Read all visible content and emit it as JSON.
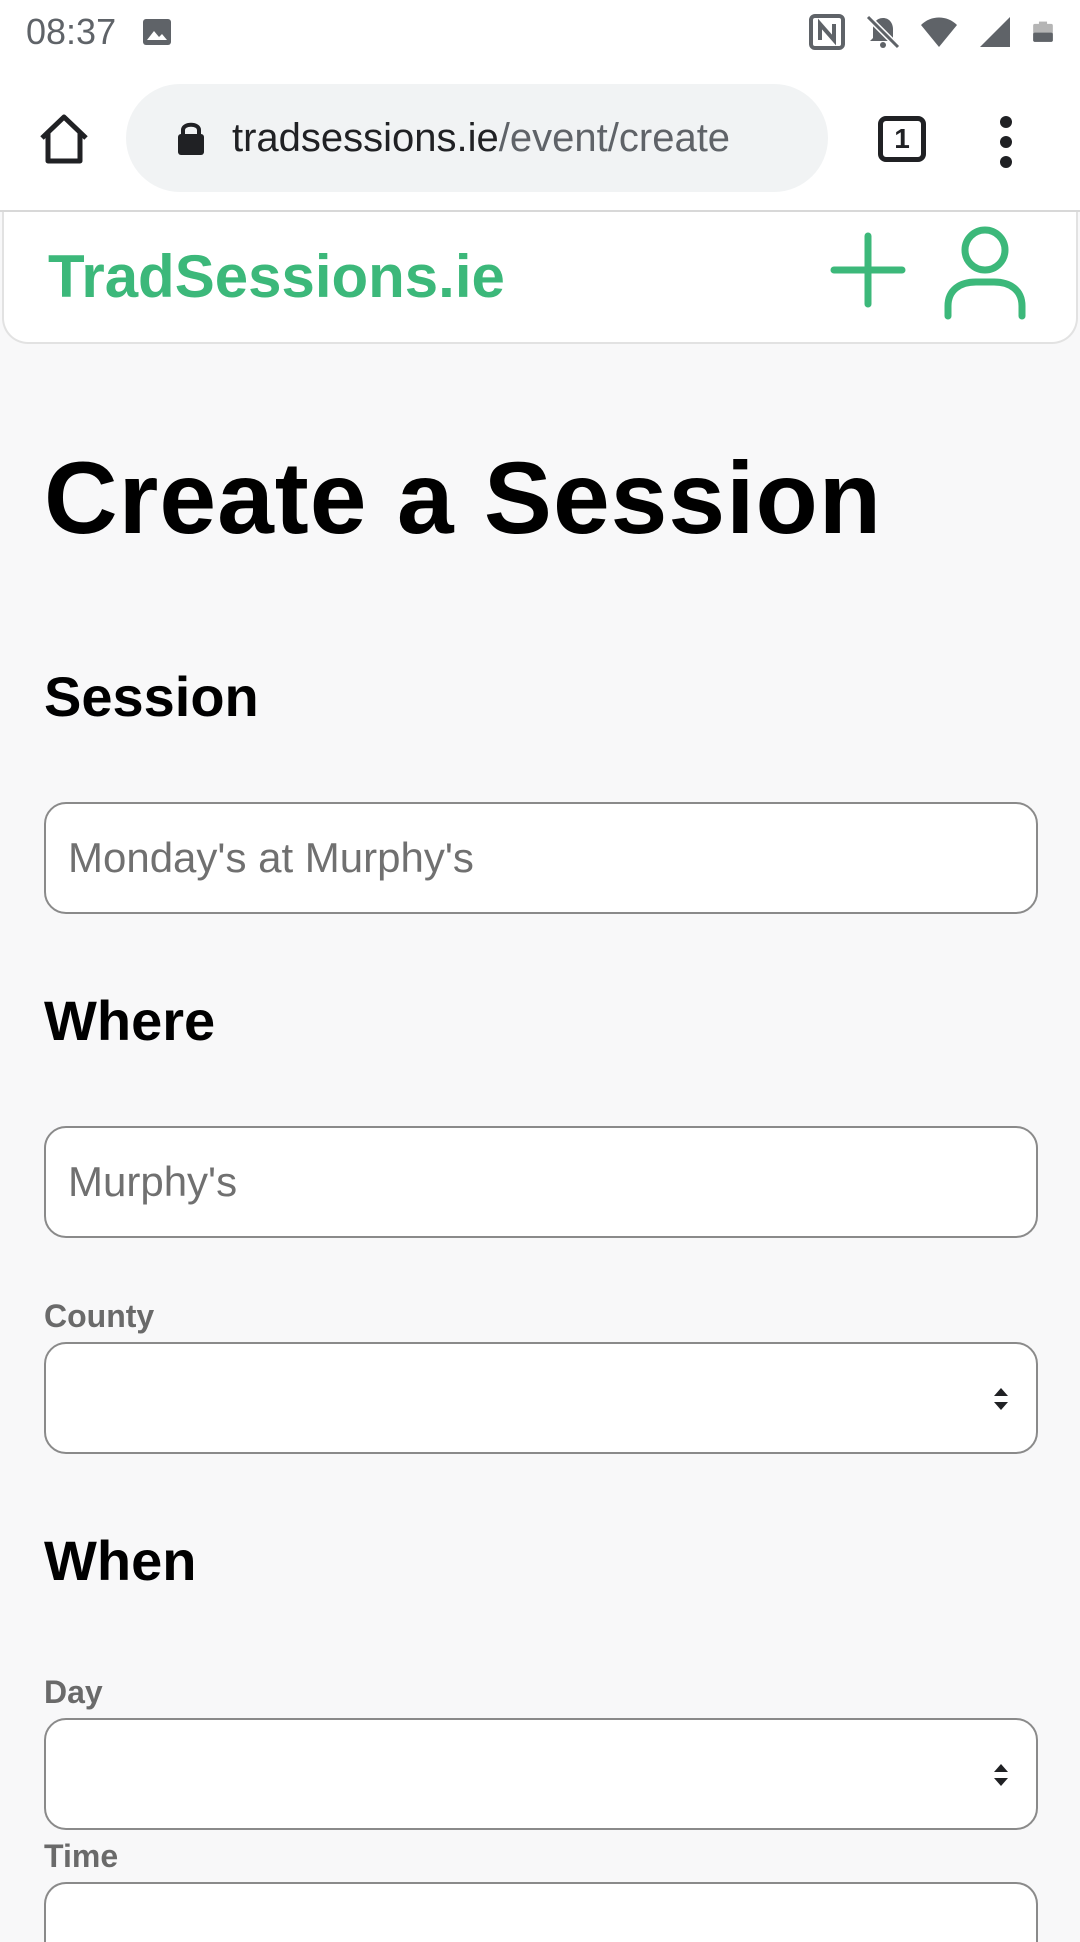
{
  "status_bar": {
    "time": "08:37",
    "icons": [
      "image-icon",
      "nfc-icon",
      "bell-off-icon",
      "wifi-icon",
      "signal-icon",
      "battery-icon"
    ]
  },
  "browser": {
    "url_domain": "tradsessions.ie",
    "url_path": "/event/create",
    "tab_count": "1"
  },
  "site": {
    "brand": "TradSessions.ie",
    "accent_color": "#3cb87a"
  },
  "page": {
    "title": "Create a Session",
    "session_heading": "Session",
    "session_placeholder": "Monday's at Murphy's",
    "where_heading": "Where",
    "where_placeholder": "Murphy's",
    "county_label": "County",
    "county_value": "",
    "when_heading": "When",
    "day_label": "Day",
    "day_value": "",
    "time_label": "Time"
  }
}
